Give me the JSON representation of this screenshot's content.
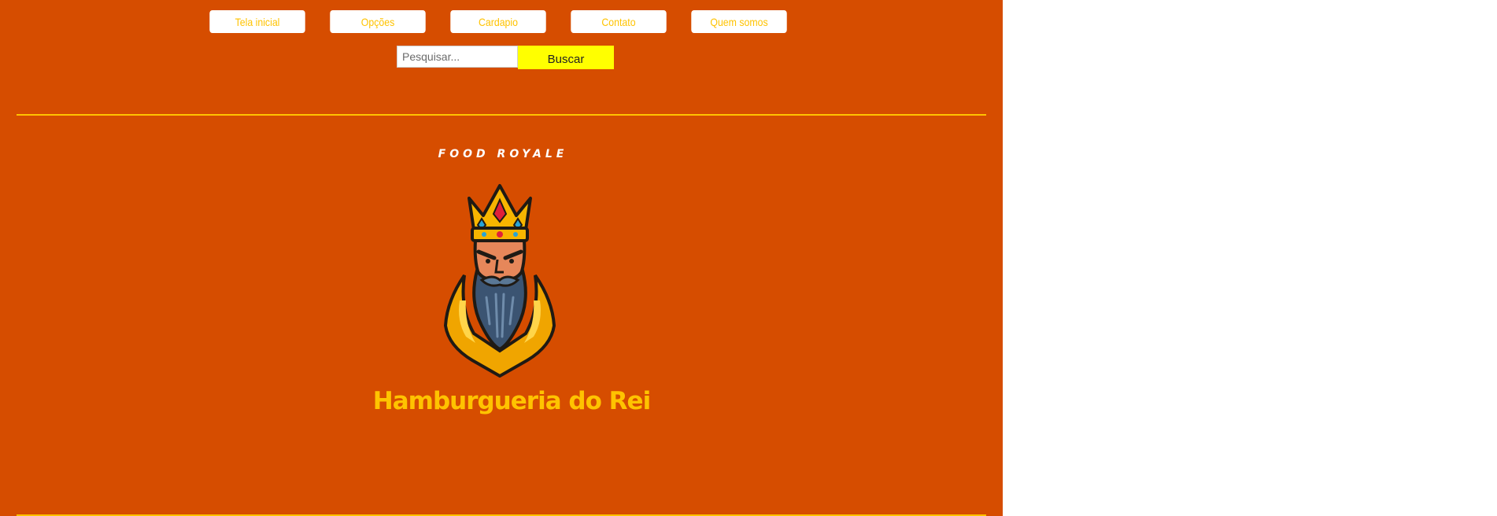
{
  "nav": {
    "items": [
      {
        "label": "Tela inicial"
      },
      {
        "label": "Opções"
      },
      {
        "label": "Cardapio"
      },
      {
        "label": "Contato"
      },
      {
        "label": "Quem somos"
      }
    ]
  },
  "search": {
    "placeholder": "Pesquisar...",
    "button_label": "Buscar"
  },
  "brand": {
    "tagline": "FOOD ROYALE",
    "name": "Hamburgueria do Rei",
    "logo_icon": "bearded-king-mascot-icon"
  },
  "colors": {
    "background": "#d64d00",
    "accent": "#ffc300",
    "search_button": "#ffff00"
  }
}
